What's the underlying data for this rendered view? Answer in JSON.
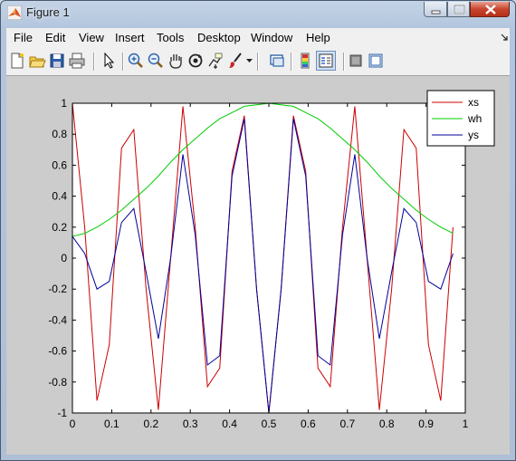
{
  "window": {
    "title": "Figure 1"
  },
  "menu": [
    "File",
    "Edit",
    "View",
    "Insert",
    "Tools",
    "Desktop",
    "Window",
    "Help"
  ],
  "toolbar_icons": [
    "new-figure-icon",
    "open-file-icon",
    "save-icon",
    "print-icon",
    "pointer-icon",
    "zoom-in-icon",
    "zoom-out-icon",
    "pan-icon",
    "rotate-3d-icon",
    "data-cursor-icon",
    "brush-icon",
    "brush-dropdown-icon",
    "link-plot-icon",
    "colorbar-icon",
    "legend-icon",
    "hide-plot-tools-icon",
    "show-plot-tools-icon"
  ],
  "colors": {
    "xs": "#cc0000",
    "wh": "#00cc00",
    "ys": "#000099"
  },
  "chart_data": {
    "type": "line",
    "xlim": [
      0,
      1
    ],
    "ylim": [
      -1,
      1
    ],
    "x_ticks": [
      "0",
      "0.1",
      "0.2",
      "0.3",
      "0.4",
      "0.5",
      "0.6",
      "0.7",
      "0.8",
      "0.9",
      "1"
    ],
    "y_ticks": [
      "1",
      "0.8",
      "0.6",
      "0.4",
      "0.2",
      "0",
      "-0.2",
      "-0.4",
      "-0.6",
      "-0.8",
      "-1"
    ],
    "legend_position": "top-right",
    "x": [
      0,
      0.03125,
      0.0625,
      0.09375,
      0.125,
      0.15625,
      0.1875,
      0.21875,
      0.25,
      0.28125,
      0.3125,
      0.34375,
      0.375,
      0.40625,
      0.4375,
      0.46875,
      0.5,
      0.53125,
      0.5625,
      0.59375,
      0.625,
      0.65625,
      0.6875,
      0.71875,
      0.75,
      0.78125,
      0.8125,
      0.84375,
      0.875,
      0.90625,
      0.9375,
      0.96875
    ],
    "series": [
      {
        "name": "xs",
        "values": [
          1,
          0.2,
          -0.92,
          -0.56,
          0.71,
          0.83,
          -0.2,
          -0.98,
          0.0,
          0.98,
          0.2,
          -0.83,
          -0.71,
          0.56,
          0.92,
          -0.2,
          -1,
          -0.2,
          0.92,
          0.56,
          -0.71,
          -0.83,
          0.2,
          0.98,
          0.0,
          -0.98,
          -0.2,
          0.83,
          0.71,
          -0.56,
          -0.92,
          0.2
        ]
      },
      {
        "name": "wh",
        "values": [
          0.14,
          0.16,
          0.2,
          0.25,
          0.31,
          0.38,
          0.45,
          0.53,
          0.62,
          0.7,
          0.77,
          0.84,
          0.9,
          0.94,
          0.98,
          0.99,
          1,
          0.99,
          0.98,
          0.94,
          0.9,
          0.84,
          0.77,
          0.7,
          0.62,
          0.53,
          0.45,
          0.38,
          0.31,
          0.25,
          0.2,
          0.16
        ]
      },
      {
        "name": "ys",
        "values": [
          0.14,
          0.03,
          -0.2,
          -0.15,
          0.23,
          0.32,
          -0.09,
          -0.52,
          0.0,
          0.67,
          0.15,
          -0.69,
          -0.63,
          0.53,
          0.9,
          -0.2,
          -1,
          -0.2,
          0.9,
          0.53,
          -0.63,
          -0.69,
          0.15,
          0.67,
          0.0,
          -0.52,
          -0.09,
          0.32,
          0.23,
          -0.15,
          -0.2,
          0.03
        ]
      }
    ]
  }
}
